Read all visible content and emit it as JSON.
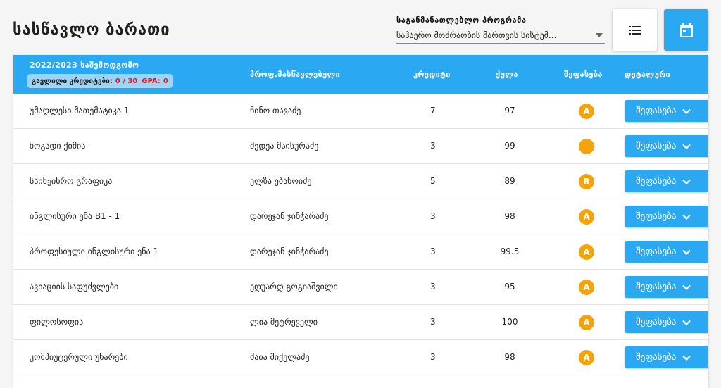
{
  "page": {
    "title": "სასწავლო ბარათი"
  },
  "program": {
    "label": "საგანმანათლებლო პროგრამა",
    "selected": "საჰაერო მოძრაობის მართვის სისტემ..."
  },
  "toolbar": {
    "list_icon": "list-icon",
    "calendar_icon": "calendar-icon"
  },
  "semester": {
    "title": "2022/2023 საშემოდგომო",
    "credits_label": "გავლილი კრედიტები:",
    "credits_value": "0 / 30",
    "gpa_label": "GPA:",
    "gpa_value": "0"
  },
  "columns": {
    "professor": "პროფ.მასწავლებელი",
    "credits": "კრედიტი",
    "score": "ქულა",
    "grade": "შეფასება",
    "details": "დეტალური"
  },
  "eval_button_label": "შეფასება",
  "colors": {
    "accent": "#2aa9f2",
    "grade": "#f5a30a",
    "alert": "#e8111e"
  },
  "rows": [
    {
      "subject": "უმაღლესი მათემატიკა 1",
      "professor": "ნინო თავაძე",
      "credits": "7",
      "score": "97",
      "grade": "A"
    },
    {
      "subject": "ზოგადი ქიმია",
      "professor": "მედეა მაისურაძე",
      "credits": "3",
      "score": "99",
      "grade": ""
    },
    {
      "subject": "საინჟინრო გრაფიკა",
      "professor": "ელზა ებანოიძე",
      "credits": "5",
      "score": "89",
      "grade": "B"
    },
    {
      "subject": "ინგლისური ენა B1 - 1",
      "professor": "დარეჯან ჯინჭარაძე",
      "credits": "3",
      "score": "98",
      "grade": "A"
    },
    {
      "subject": "პროფესიული ინგლისური ენა 1",
      "professor": "დარეჯან ჯინჭარაძე",
      "credits": "3",
      "score": "99.5",
      "grade": "A"
    },
    {
      "subject": "ავიაციის საფუძვლები",
      "professor": "ედუარდ გოგიაშვილი",
      "credits": "3",
      "score": "95",
      "grade": "A"
    },
    {
      "subject": "ფილოსოფია",
      "professor": "ლია მეტრეველი",
      "credits": "3",
      "score": "100",
      "grade": "A"
    },
    {
      "subject": "კომპიუტერული უნარები",
      "professor": "მაია მიქელაძე",
      "credits": "3",
      "score": "98",
      "grade": "A"
    }
  ]
}
